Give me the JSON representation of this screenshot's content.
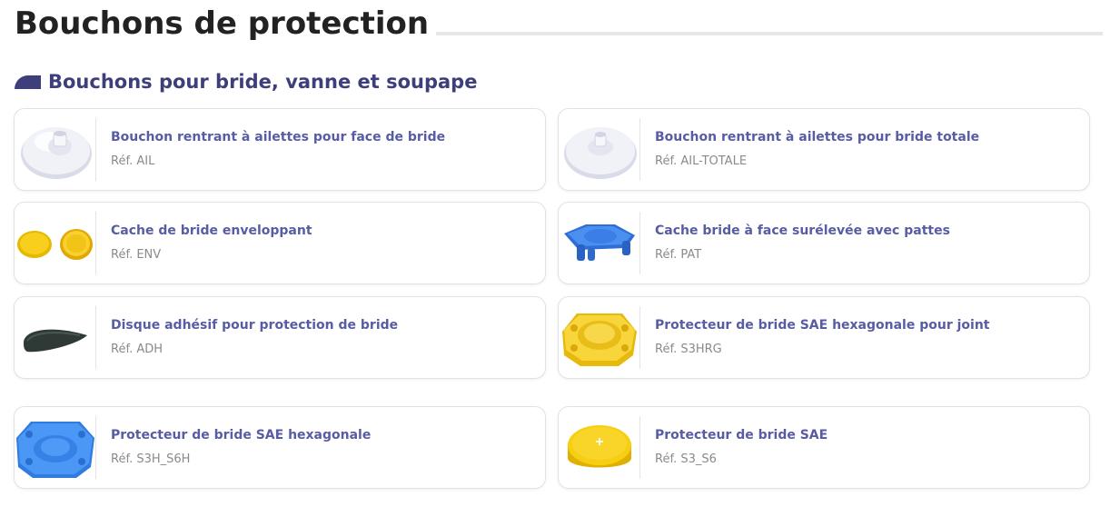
{
  "page": {
    "title": "Bouchons de protection"
  },
  "section": {
    "title": "Bouchons pour bride, vanne et soupape"
  },
  "ref_prefix": "Réf.",
  "products": [
    {
      "name": "Bouchon rentrant à ailettes pour face de bride",
      "ref": "Réf. AIL",
      "image": "white-finned-plug-icon"
    },
    {
      "name": "Bouchon rentrant à ailettes pour bride totale",
      "ref": "Réf. AIL-TOTALE",
      "image": "white-finned-plug-icon"
    },
    {
      "name": "Cache de bride enveloppant",
      "ref": "Réf. ENV",
      "image": "yellow-caps-icon"
    },
    {
      "name": "Cache bride à face surélevée avec pattes",
      "ref": "Réf. PAT",
      "image": "blue-legged-cover-icon"
    },
    {
      "name": "Disque adhésif pour protection de bride",
      "ref": "Réf. ADH",
      "image": "black-adhesive-disc-icon"
    },
    {
      "name": "Protecteur de bride SAE hexagonale pour joint",
      "ref": "Réf. S3HRG",
      "image": "yellow-sae-flange-icon"
    },
    {
      "name": "Protecteur de bride SAE hexagonale",
      "ref": "Réf. S3H_S6H",
      "image": "blue-sae-flange-icon"
    },
    {
      "name": "Protecteur de bride SAE",
      "ref": "Réf. S3_S6",
      "image": "yellow-round-cap-icon"
    }
  ],
  "colors": {
    "title": "#222222",
    "section": "#3d3e7a",
    "product_link": "#585ca4",
    "ref_text": "#8a8a8a",
    "card_border": "#e2e2e2"
  }
}
